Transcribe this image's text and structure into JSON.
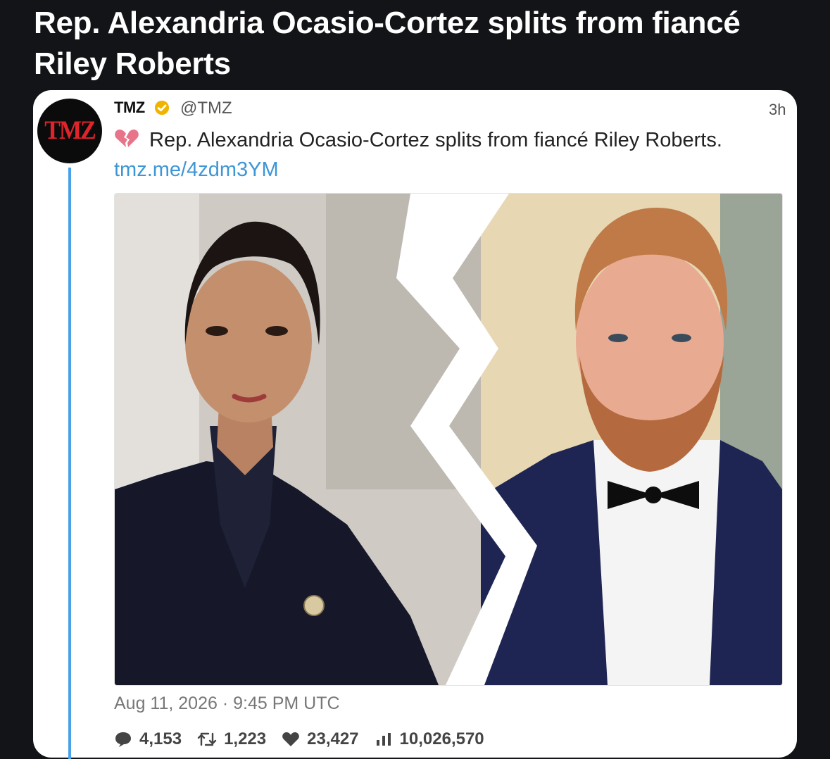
{
  "headline": "Rep. Alexandria Ocasio-Cortez splits from fiancé Riley Roberts",
  "tweet": {
    "avatar_text": "TMZ",
    "author_name": "TMZ",
    "handle": "@TMZ",
    "time": "3h",
    "text_main": "Rep. Alexandria Ocasio-Cortez splits from fiancé Riley Roberts.",
    "link": "tmz.me/4zdm3YM",
    "date": "Aug 11, 2026 · 9:45 PM UTC",
    "stats": {
      "replies": "4,153",
      "retweets": "1,223",
      "likes": "23,427",
      "views": "10,026,570"
    }
  },
  "colors": {
    "background": "#121417",
    "thread_line": "#4aa1e8",
    "link": "#3d96d6",
    "verified": "#f0b400",
    "broken_heart": "#e8748a"
  },
  "icons": [
    "verified-badge-icon",
    "broken-heart-icon",
    "reply-icon",
    "retweet-icon",
    "like-icon",
    "views-icon"
  ]
}
